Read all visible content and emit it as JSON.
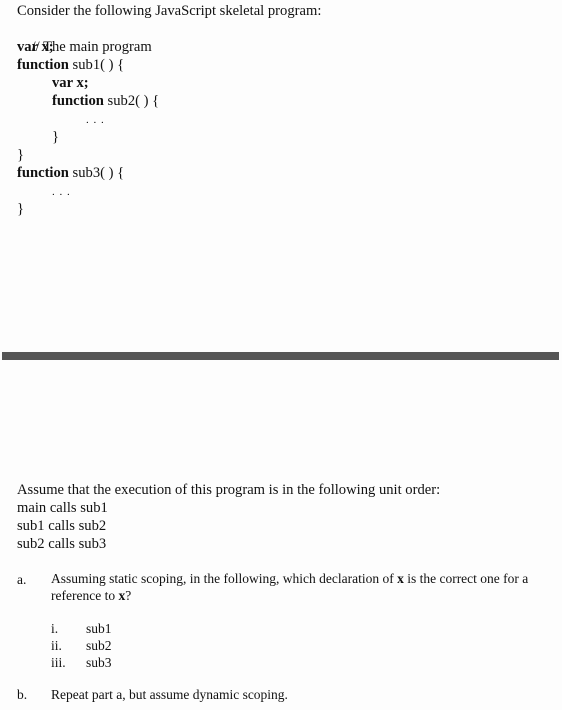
{
  "upper_section": {
    "intro": "Consider the following JavaScript skeletal program:",
    "code_lines": [
      {
        "kw": "",
        "text": "// The main program"
      },
      {
        "kw": "var",
        "text": " x;"
      },
      {
        "kw": "function",
        "text": " sub1( ) {"
      },
      {
        "kw": "var",
        "text": " x;"
      },
      {
        "kw": "function",
        "text": " sub2( ) {"
      },
      {
        "kw": "",
        "text": ". . ."
      },
      {
        "kw": "",
        "text": "}"
      },
      {
        "kw": "",
        "text": "}"
      },
      {
        "kw": "function",
        "text": " sub3( ) {"
      },
      {
        "kw": "",
        "text": ". . ."
      },
      {
        "kw": "",
        "text": "}"
      }
    ]
  },
  "divider": {
    "color": "#555555"
  },
  "lower_section": {
    "intro": "Assume that the execution of this program is in the following unit order:",
    "call_order": [
      "main calls sub1",
      "sub1 calls sub2",
      "sub2 calls sub3"
    ],
    "questions": [
      {
        "label": "a.",
        "text_line1_pre": "Assuming static scoping, in the following, which declaration of ",
        "text_line1_var": "x",
        "text_line1_post": " is the correct one for a",
        "text_line2_pre": "reference to ",
        "text_line2_var": "x",
        "text_line2_post": "?",
        "options": [
          {
            "label": "i.",
            "value": "sub1"
          },
          {
            "label": "ii.",
            "value": "sub2"
          },
          {
            "label": "iii.",
            "value": "sub3"
          }
        ]
      },
      {
        "label": "b.",
        "text": "Repeat part a, but assume dynamic scoping."
      }
    ]
  }
}
